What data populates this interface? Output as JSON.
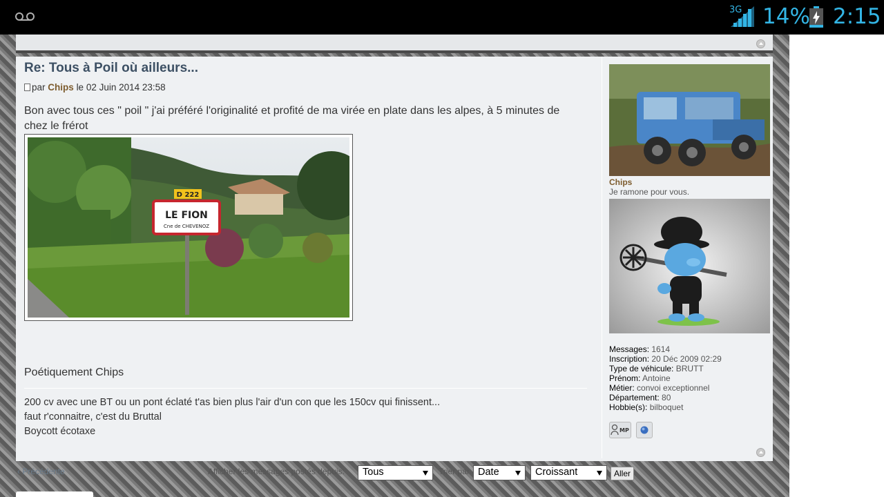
{
  "statusbar": {
    "network": "3G",
    "battery_percent": "14%",
    "clock": "2:15",
    "battery_level": 0.14,
    "icons": [
      "voicemail-icon",
      "signal-icon",
      "battery-charging-icon"
    ]
  },
  "post": {
    "title": "Re: Tous à Poil où ailleurs...",
    "meta_prefix": "par",
    "author": "Chips",
    "meta_date": "le 02 Juin 2014 23:58",
    "body": "Bon avec tous ces \" poil \" j'ai préféré l'originalité et profité de ma virée en plate dans les alpes, à 5 minutes de chez le frérot",
    "photo": {
      "sign_road": "D 222",
      "sign_town": "LE FION",
      "sign_commune": "Cne de CHEVENOZ"
    },
    "signoff": "Poétiquement Chips",
    "signature": [
      "200 cv avec une BT ou un pont éclaté t'as bien plus l'air d'un con que les 150cv qui finissent...",
      "faut r'connaitre, c'est du Bruttal",
      "Boycott écotaxe"
    ]
  },
  "profile": {
    "name": "Chips",
    "rank": "Je ramone pour vous.",
    "details": [
      {
        "label": "Messages:",
        "value": "1614"
      },
      {
        "label": "Inscription:",
        "value": "20 Déc 2009 02:29"
      },
      {
        "label": "Type de véhicule:",
        "value": "BRUTT"
      },
      {
        "label": "Prénom:",
        "value": "Antoine"
      },
      {
        "label": "Métier:",
        "value": "convoi exceptionnel"
      },
      {
        "label": "Département:",
        "value": "80"
      },
      {
        "label": "Hobbie(s):",
        "value": "bilboquet"
      }
    ],
    "contact_pm": "MP"
  },
  "bottomnav": {
    "previous": "Précédente",
    "display_from": "Afficher les messages postés depuis:",
    "sort_by": "Trier par",
    "filter_value": "Tous",
    "sort_value": "Date",
    "order_value": "Croissant",
    "go_label": "Aller"
  },
  "colors": {
    "title": "#3d5064",
    "author": "#7d5c2e",
    "status_accent": "#33b5e5"
  }
}
